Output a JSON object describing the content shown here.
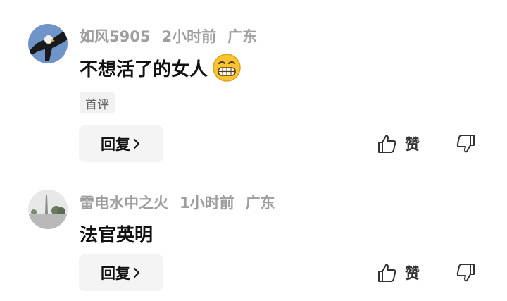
{
  "comments": [
    {
      "username": "如风5905",
      "time": "2小时前",
      "location": "广东",
      "text": "不想活了的女人",
      "emoji": "grinning-face-emoji",
      "tag": "首评",
      "reply_label": "回复",
      "like_label": "赞",
      "icons": {
        "like": "thumbs-up-icon",
        "dislike": "thumbs-down-icon",
        "reply": "chevron-right-icon"
      }
    },
    {
      "username": "雷电水中之火",
      "time": "1小时前",
      "location": "广东",
      "text": "法官英明",
      "reply_label": "回复",
      "like_label": "赞",
      "icons": {
        "like": "thumbs-up-icon",
        "dislike": "thumbs-down-icon",
        "reply": "chevron-right-icon"
      }
    }
  ],
  "colors": {
    "meta": "#9e9e9e",
    "text": "#111111",
    "button_bg": "#f4f4f4"
  }
}
